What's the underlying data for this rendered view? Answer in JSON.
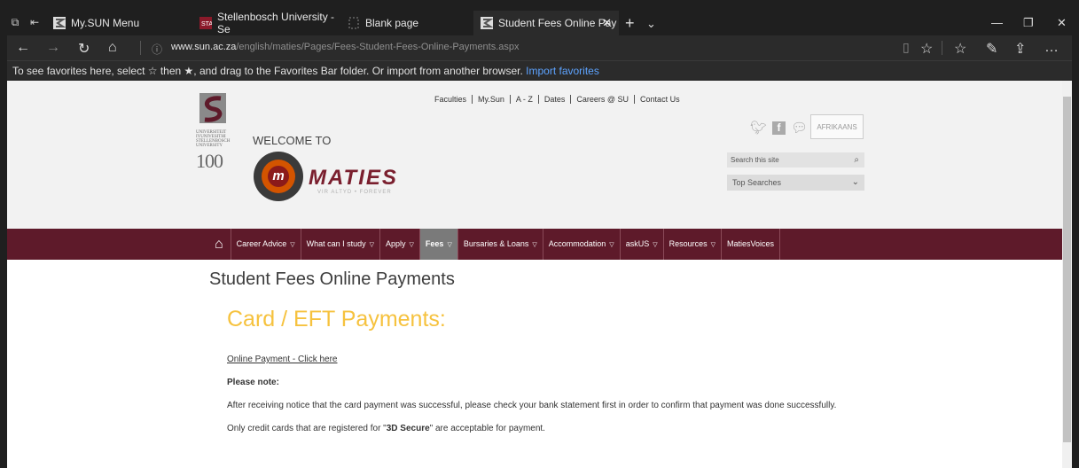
{
  "browser": {
    "tabs": [
      {
        "label": "My.SUN Menu"
      },
      {
        "label": "Stellenbosch University - Se"
      },
      {
        "label": "Blank page"
      },
      {
        "label": "Student Fees Online Pay"
      }
    ],
    "url_domain": "www.sun.ac.za",
    "url_path": "/english/maties/Pages/Fees-Student-Fees-Online-Payments.aspx",
    "favorites_hint": "To see favorites here, select ☆ then ★, and drag to the Favorites Bar folder. Or import from another browser.",
    "favorites_link": "Import favorites"
  },
  "site": {
    "top_links": [
      "Faculties",
      "My.Sun",
      "A - Z",
      "Dates",
      "Careers @ SU",
      "Contact Us"
    ],
    "welcome": "WELCOME TO",
    "logo_text": "MATIES",
    "logo_mark": "m",
    "motto": "VIR ALTYD • FOREVER",
    "hundred": "100",
    "afrikaans_button": "AFRIKAANS",
    "search_placeholder": "Search this site",
    "top_searches": "Top Searches",
    "nav": [
      {
        "label": "Career Advice"
      },
      {
        "label": "What can I study"
      },
      {
        "label": "Apply"
      },
      {
        "label": "Fees"
      },
      {
        "label": "Bursaries & Loans"
      },
      {
        "label": "Accommodation"
      },
      {
        "label": "askUS"
      },
      {
        "label": "Resources"
      },
      {
        "label": "MatiesVoices"
      }
    ]
  },
  "content": {
    "title": "Student Fees Online Payments",
    "subtitle": "Card / EFT Payments:",
    "payment_link": "Online Payment - Click here",
    "note_label": "Please note:",
    "note_1": "After receiving notice that the card payment was successful, please check your bank statement first in order to confirm that payment was done successfully.",
    "note_2_pre": "Only credit cards that are registered for \"",
    "note_2_bold": "3D Secure",
    "note_2_post": "\" are acceptable for payment."
  },
  "colors": {
    "nav_bg": "#5e1a2a",
    "accent_yellow": "#f6c23e",
    "brand_maroon": "#7a1f2e"
  }
}
